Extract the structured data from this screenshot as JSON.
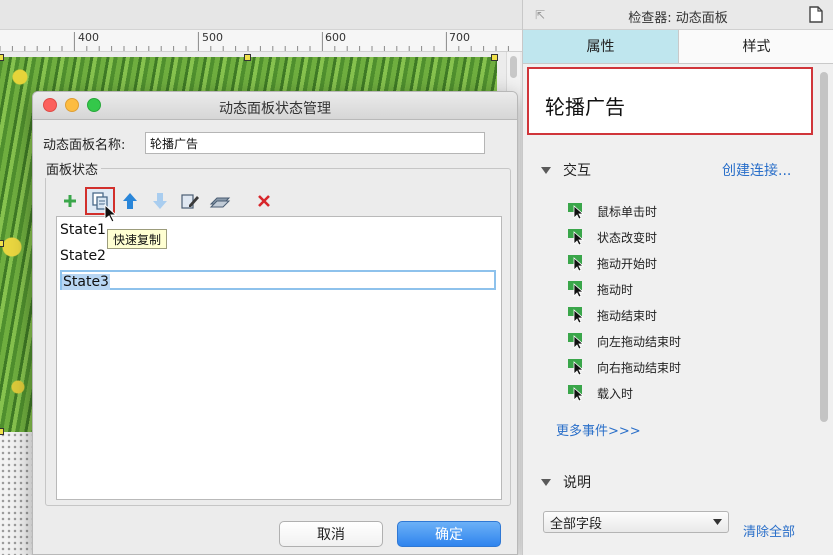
{
  "ruler": {
    "ticks": [
      "400",
      "500",
      "600",
      "700"
    ]
  },
  "dialog": {
    "title": "动态面板状态管理",
    "name_label": "动态面板名称:",
    "name_value": "轮播广告",
    "states_label": "面板状态",
    "tooltip": "快速复制",
    "states": [
      "State1",
      "State2",
      "State3"
    ],
    "selected_state_index": 2,
    "cancel_label": "取消",
    "ok_label": "确定",
    "toolbar_icons": [
      "add-icon",
      "duplicate-icon",
      "arrow-up-icon",
      "arrow-down-icon",
      "edit-state-icon",
      "edit-all-states-icon",
      "delete-icon"
    ]
  },
  "inspector": {
    "title": "检查器: 动态面板",
    "tabs": [
      "属性",
      "样式"
    ],
    "active_tab": "属性",
    "widget_name": "轮播广告",
    "interaction_label": "交互",
    "create_link_label": "创建连接...",
    "events": [
      "鼠标单击时",
      "状态改变时",
      "拖动开始时",
      "拖动时",
      "拖动结束时",
      "向左拖动结束时",
      "向右拖动结束时",
      "载入时"
    ],
    "more_events_label": "更多事件>>>",
    "description_label": "说明",
    "field_select_value": "全部字段",
    "clear_all_label": "清除全部"
  },
  "colors": {
    "accent_blue": "#2f84ee",
    "active_tab_bg": "#bfe6ee",
    "highlight_red": "#d0353a",
    "link_blue": "#2a6fc9",
    "event_icon_green": "#3aa64a"
  }
}
